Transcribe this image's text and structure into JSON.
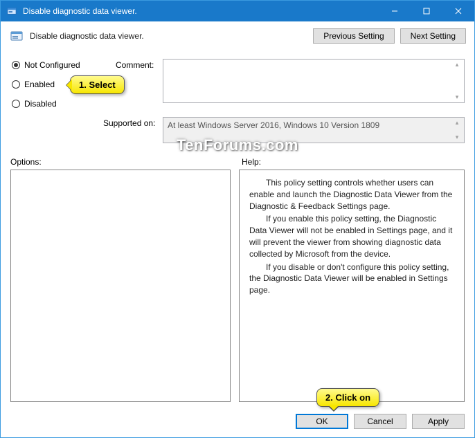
{
  "window": {
    "title": "Disable diagnostic data viewer."
  },
  "header": {
    "policy_title": "Disable diagnostic data viewer.",
    "previous_setting": "Previous Setting",
    "next_setting": "Next Setting"
  },
  "radios": {
    "not_configured": "Not Configured",
    "enabled": "Enabled",
    "disabled": "Disabled",
    "selected": "not_configured"
  },
  "labels": {
    "comment": "Comment:",
    "supported_on": "Supported on:",
    "options": "Options:",
    "help": "Help:"
  },
  "supported_text": "At least Windows Server 2016, Windows 10 Version 1809",
  "help_text": {
    "p1": "This policy setting controls whether users can enable and launch the Diagnostic Data Viewer from the Diagnostic & Feedback Settings page.",
    "p2": "If you enable this policy setting, the Diagnostic Data Viewer will not be enabled in Settings page, and it will prevent the viewer from showing diagnostic data collected by Microsoft from the device.",
    "p3": "If you disable or don't configure this policy setting, the Diagnostic Data Viewer will be enabled in Settings page."
  },
  "footer": {
    "ok": "OK",
    "cancel": "Cancel",
    "apply": "Apply"
  },
  "callouts": {
    "c1": "1. Select",
    "c2": "2. Click on"
  },
  "watermark": "TenForums.com"
}
